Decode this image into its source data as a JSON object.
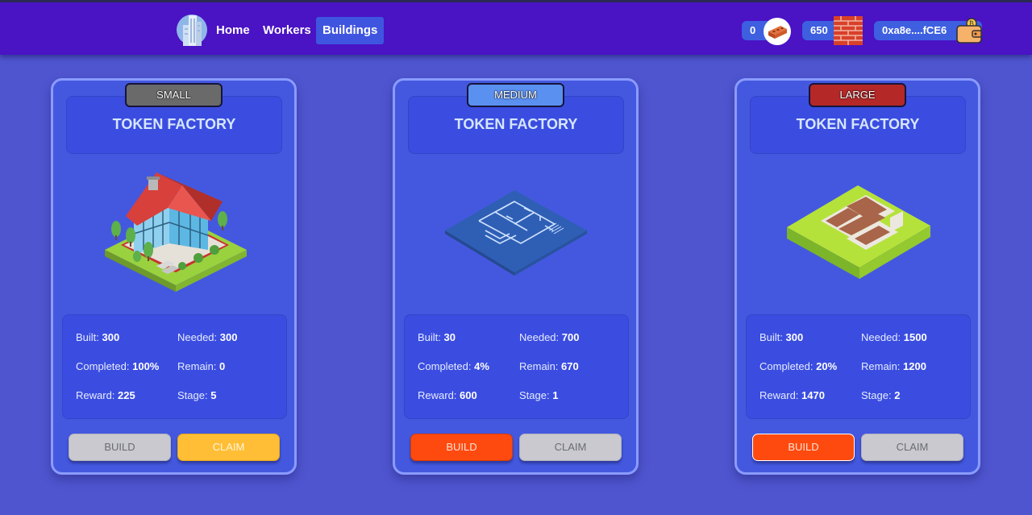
{
  "nav": {
    "home": "Home",
    "workers": "Workers",
    "buildings": "Buildings",
    "active": "Buildings"
  },
  "resources": {
    "bricks": "0",
    "walls": "650",
    "wallet": "0xa8e....fCE6"
  },
  "icons": {
    "logo": "city-skyscraper-logo",
    "bricks": "brick-icon",
    "walls": "brick-wall-icon",
    "wallet": "wallet-icon"
  },
  "colors": {
    "topbar": "#4a13c4",
    "background": "#4f55cf",
    "card": "#4458df",
    "panel": "#3b4de0",
    "title": "#d6e6ff",
    "active_tab": "#3f55e0",
    "badge_small": "#6a6a6a",
    "badge_medium": "#5a90f0",
    "badge_large": "#b52828",
    "button_gray": "#c9c9cf",
    "button_orange": "#ffbe35",
    "button_red": "#ff4a0f"
  },
  "cards": [
    {
      "size": "SMALL",
      "title": "TOKEN FACTORY",
      "illustration": "isometric-house",
      "stats": {
        "built_label": "Built:",
        "built": "300",
        "needed_label": "Needed:",
        "needed": "300",
        "completed_label": "Completed:",
        "completed": "100%",
        "remain_label": "Remain:",
        "remain": "0",
        "reward_label": "Reward:",
        "reward": "225",
        "stage_label": "Stage:",
        "stage": "5"
      },
      "build_label": "BUILD",
      "claim_label": "CLAIM"
    },
    {
      "size": "MEDIUM",
      "title": "TOKEN FACTORY",
      "illustration": "isometric-blueprint",
      "stats": {
        "built_label": "Built:",
        "built": "30",
        "needed_label": "Needed:",
        "needed": "700",
        "completed_label": "Completed:",
        "completed": "4%",
        "remain_label": "Remain:",
        "remain": "670",
        "reward_label": "Reward:",
        "reward": "600",
        "stage_label": "Stage:",
        "stage": "1"
      },
      "build_label": "BUILD",
      "claim_label": "CLAIM"
    },
    {
      "size": "LARGE",
      "title": "TOKEN FACTORY",
      "illustration": "isometric-foundation",
      "stats": {
        "built_label": "Built:",
        "built": "300",
        "needed_label": "Needed:",
        "needed": "1500",
        "completed_label": "Completed:",
        "completed": "20%",
        "remain_label": "Remain:",
        "remain": "1200",
        "reward_label": "Reward:",
        "reward": "1470",
        "stage_label": "Stage:",
        "stage": "2"
      },
      "build_label": "BUILD",
      "claim_label": "CLAIM"
    }
  ]
}
